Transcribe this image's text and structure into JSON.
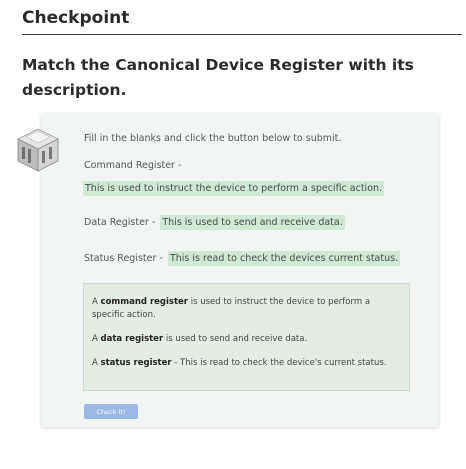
{
  "checkpoint": {
    "title": "Checkpoint"
  },
  "question": {
    "title": "Match the Canonical Device Register with its description."
  },
  "activity": {
    "instructions": "Fill in the blanks and click the button below to submit.",
    "rows": [
      {
        "label": "Command Register -",
        "answer": "This is used to instruct the device to perform a specific action."
      },
      {
        "label": "Data Register -",
        "answer": "This is used to send and receive data."
      },
      {
        "label": "Status Register -",
        "answer": "This is read to check the devices current status."
      }
    ],
    "summary": [
      {
        "prefix": "A",
        "term": "command register",
        "rest": "is used to instruct the device to perform a specific action."
      },
      {
        "prefix": "A",
        "term": "data register",
        "rest": "is used to send and receive data."
      },
      {
        "prefix": "A",
        "term": "status register",
        "rest": "- This is read to check the device's current status."
      }
    ],
    "button_label": "Check It!"
  },
  "icon": {
    "name": "device-register-icon"
  },
  "colors": {
    "answer_highlight": "#cfe9d3",
    "card_bg": "#f1f6f2",
    "button": "#9cb8e4"
  }
}
